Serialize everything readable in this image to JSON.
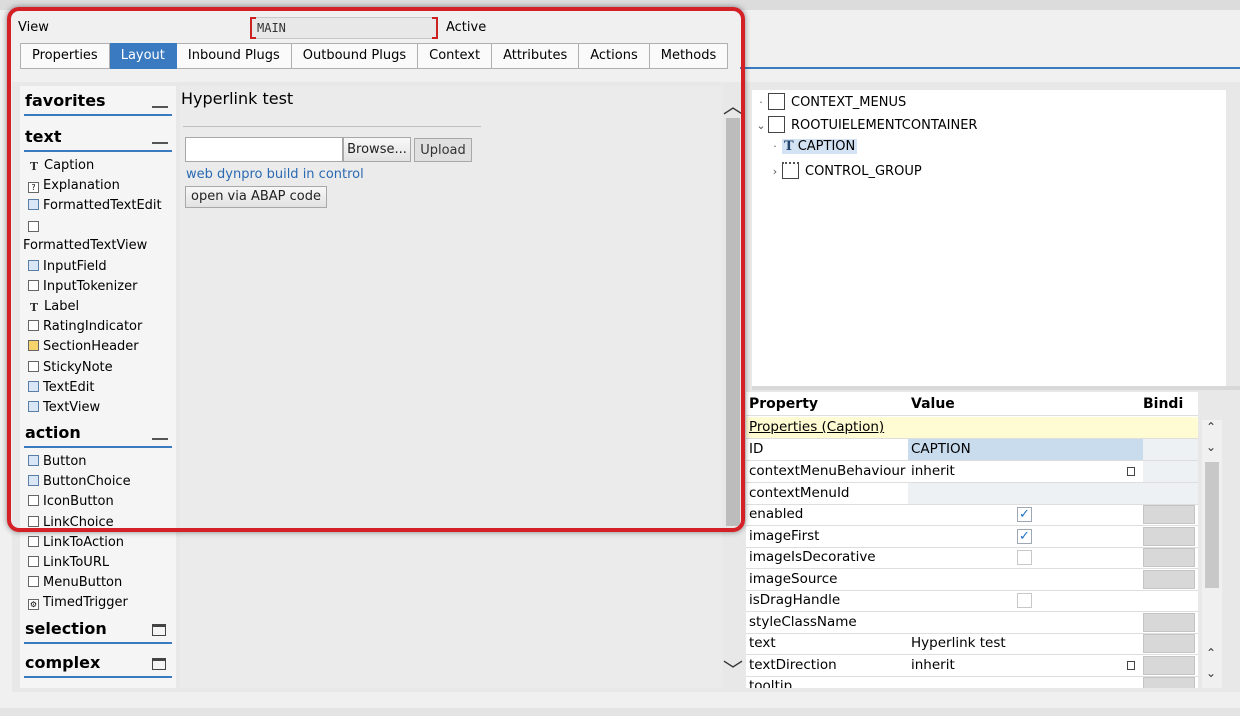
{
  "view": {
    "label": "View",
    "name": "MAIN",
    "status": "Active"
  },
  "tabs": [
    {
      "label": "Properties"
    },
    {
      "label": "Layout"
    },
    {
      "label": "Inbound Plugs"
    },
    {
      "label": "Outbound Plugs"
    },
    {
      "label": "Context"
    },
    {
      "label": "Attributes"
    },
    {
      "label": "Actions"
    },
    {
      "label": "Methods"
    }
  ],
  "palette": {
    "favorites": "favorites",
    "text": {
      "title": "text",
      "items": [
        "Caption",
        "Explanation",
        "FormattedTextEdit",
        "FormattedTextView",
        "InputField",
        "InputTokenizer",
        "Label",
        "RatingIndicator",
        "SectionHeader",
        "StickyNote",
        "TextEdit",
        "TextView"
      ]
    },
    "action": {
      "title": "action",
      "items": [
        "Button",
        "ButtonChoice",
        "IconButton",
        "LinkChoice",
        "LinkToAction",
        "LinkToURL",
        "MenuButton",
        "TimedTrigger"
      ]
    },
    "selection": "selection",
    "complex": "complex"
  },
  "canvas": {
    "caption": "Hyperlink test",
    "browse": "Browse...",
    "upload": "Upload",
    "link": "web dynpro build in control",
    "abap_button": "open via ABAP code"
  },
  "tree": {
    "context_menus": "CONTEXT_MENUS",
    "root": "ROOTUIELEMENTCONTAINER",
    "caption": "CAPTION",
    "control_group": "CONTROL_GROUP",
    "t_glyph": "T"
  },
  "props": {
    "headers": {
      "property": "Property",
      "value": "Value",
      "binding": "Bindi"
    },
    "section": "Properties (Caption)",
    "rows": [
      {
        "name": "ID",
        "value": "CAPTION"
      },
      {
        "name": "contextMenuBehaviour",
        "value": "inherit"
      },
      {
        "name": "contextMenuId",
        "value": ""
      },
      {
        "name": "enabled",
        "value": ""
      },
      {
        "name": "imageFirst",
        "value": ""
      },
      {
        "name": "imageIsDecorative",
        "value": ""
      },
      {
        "name": "imageSource",
        "value": ""
      },
      {
        "name": "isDragHandle",
        "value": ""
      },
      {
        "name": "styleClassName",
        "value": ""
      },
      {
        "name": "text",
        "value": "Hyperlink test"
      },
      {
        "name": "textDirection",
        "value": "inherit"
      },
      {
        "name": "tooltip",
        "value": ""
      }
    ],
    "checked": {
      "enabled": true,
      "imageFirst": true,
      "imageIsDecorative": false,
      "isDragHandle": false
    }
  },
  "colors": {
    "accent": "#3a7ac1",
    "highlight": "#d42027",
    "link": "#2a6ab2",
    "section_bg": "#fffbd3"
  }
}
